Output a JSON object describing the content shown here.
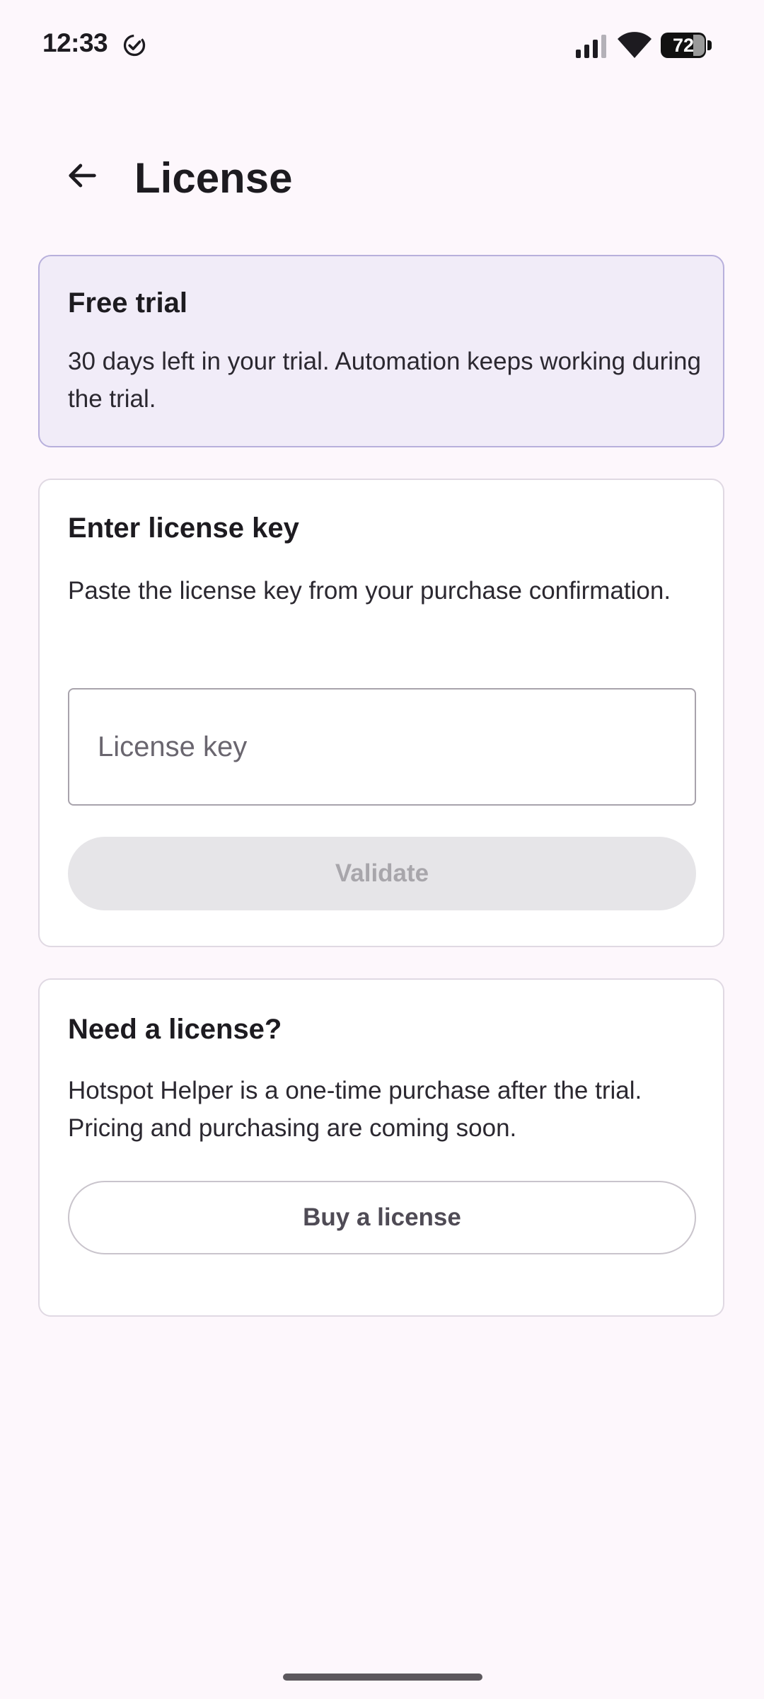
{
  "status_bar": {
    "time": "12:33",
    "battery_level": "72",
    "icons": [
      "check-circle-icon",
      "signal-icon",
      "wifi-icon",
      "battery-icon"
    ]
  },
  "app_bar": {
    "title": "License",
    "back_icon": "arrow-left-icon"
  },
  "trial_card": {
    "title": "Free trial",
    "text": "30 days left in your trial. Automation keeps working during the trial."
  },
  "license_key_card": {
    "title": "Enter license key",
    "text": "Paste the license key from your purchase confirmation.",
    "input_placeholder": "License key",
    "input_value": "",
    "validate_label": "Validate"
  },
  "need_license_card": {
    "title": "Need a license?",
    "text": "Hotspot Helper is a one-time purchase after the trial. Pricing and purchasing are coming soon.",
    "buy_label": "Buy a license"
  },
  "colors": {
    "background": "#fdf7fc",
    "trial_card_bg": "#f1ecf8",
    "trial_card_border": "#b8b0dc",
    "disabled_button_bg": "#e6e5e8"
  }
}
